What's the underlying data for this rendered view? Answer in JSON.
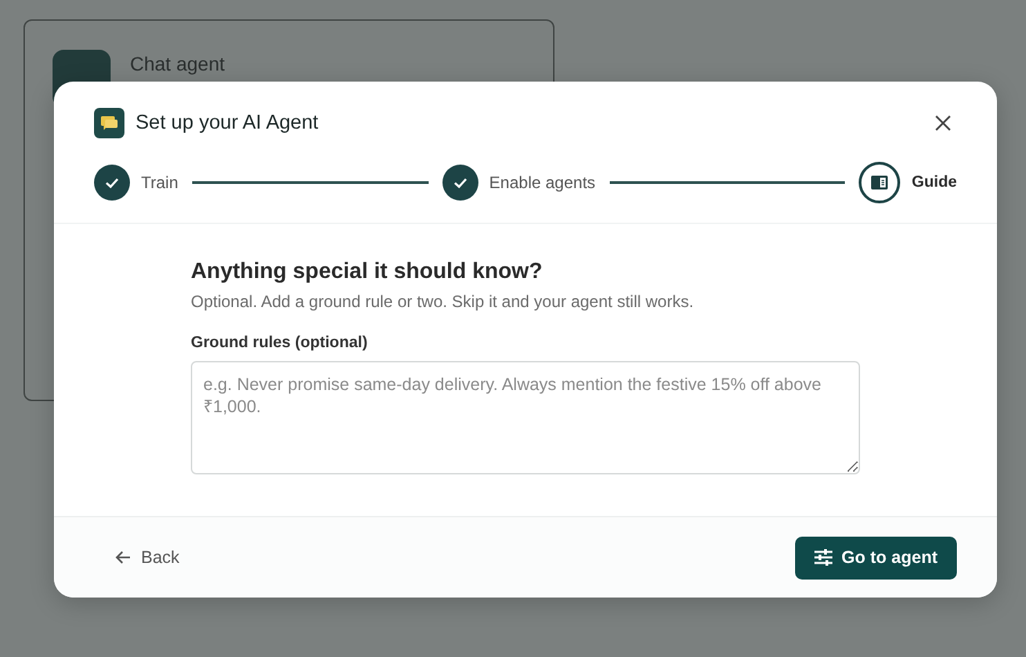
{
  "background_card": {
    "title": "Chat agent"
  },
  "dialog": {
    "title": "Set up your AI Agent",
    "steps": [
      {
        "label": "Train",
        "done": true
      },
      {
        "label": "Enable agents",
        "done": true
      },
      {
        "label": "Guide",
        "done": false
      }
    ],
    "heading": "Anything special it should know?",
    "subtitle": "Optional. Add a ground rule or two. Skip it and your agent still works.",
    "field": {
      "label": "Ground rules (optional)",
      "placeholder": "e.g. Never promise same-day delivery. Always mention the festive 15% off above ₹1,000."
    },
    "back_button": "Back",
    "primary_button": "Go to agent"
  }
}
